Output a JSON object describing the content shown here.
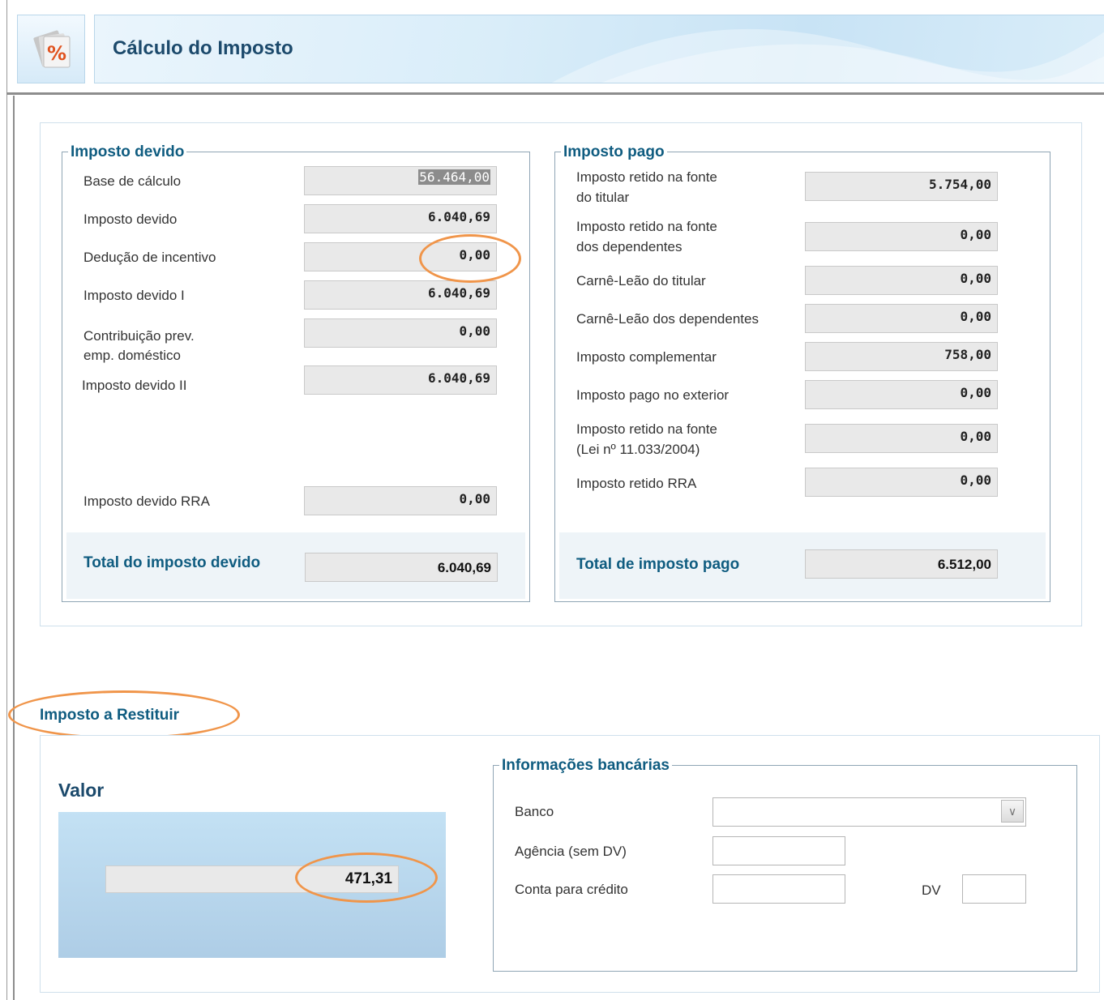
{
  "header": {
    "title": "Cálculo do Imposto",
    "icon": "percent-document-icon",
    "icon_glyph": "%"
  },
  "imposto_devido": {
    "legend": "Imposto devido",
    "rows": [
      {
        "label": "Base de cálculo",
        "value": "56.464,00"
      },
      {
        "label": "Imposto devido",
        "value": "6.040,69"
      },
      {
        "label": "Dedução de incentivo",
        "value": "0,00"
      },
      {
        "label": "Imposto devido I",
        "value": "6.040,69"
      },
      {
        "label_line1": "Contribuição prev.",
        "label_line2": "emp. doméstico",
        "value": "0,00"
      },
      {
        "label": "Imposto devido II",
        "value": "6.040,69"
      },
      {
        "label": "Imposto devido RRA",
        "value": "0,00"
      }
    ],
    "total_label": "Total do imposto devido",
    "total_value": "6.040,69"
  },
  "imposto_pago": {
    "legend": "Imposto pago",
    "rows": [
      {
        "label_line1": "Imposto retido na fonte",
        "label_line2": "do titular",
        "value": "5.754,00"
      },
      {
        "label_line1": "Imposto retido na fonte",
        "label_line2": "dos dependentes",
        "value": "0,00"
      },
      {
        "label": "Carnê-Leão do titular",
        "value": "0,00"
      },
      {
        "label": "Carnê-Leão dos dependentes",
        "value": "0,00"
      },
      {
        "label": "Imposto complementar",
        "value": "758,00"
      },
      {
        "label": "Imposto pago no exterior",
        "value": "0,00"
      },
      {
        "label_line1": "Imposto retido na fonte",
        "label_line2": "(Lei nº 11.033/2004)",
        "value": "0,00"
      },
      {
        "label": "Imposto retido RRA",
        "value": "0,00"
      }
    ],
    "total_label": "Total de imposto pago",
    "total_value": "6.512,00"
  },
  "restituir": {
    "section_title": "Imposto a Restituir",
    "valor_title": "Valor",
    "valor": "471,31"
  },
  "bancarias": {
    "legend": "Informações bancárias",
    "banco_label": "Banco",
    "banco_value": "",
    "agencia_label": "Agência (sem DV)",
    "agencia_value": "",
    "conta_label": "Conta para crédito",
    "conta_value": "",
    "dv_label": "DV",
    "dv_value": ""
  },
  "colors": {
    "accent": "#0f5c80",
    "highlight": "#f0954a",
    "field_bg": "#e9e9e9"
  }
}
